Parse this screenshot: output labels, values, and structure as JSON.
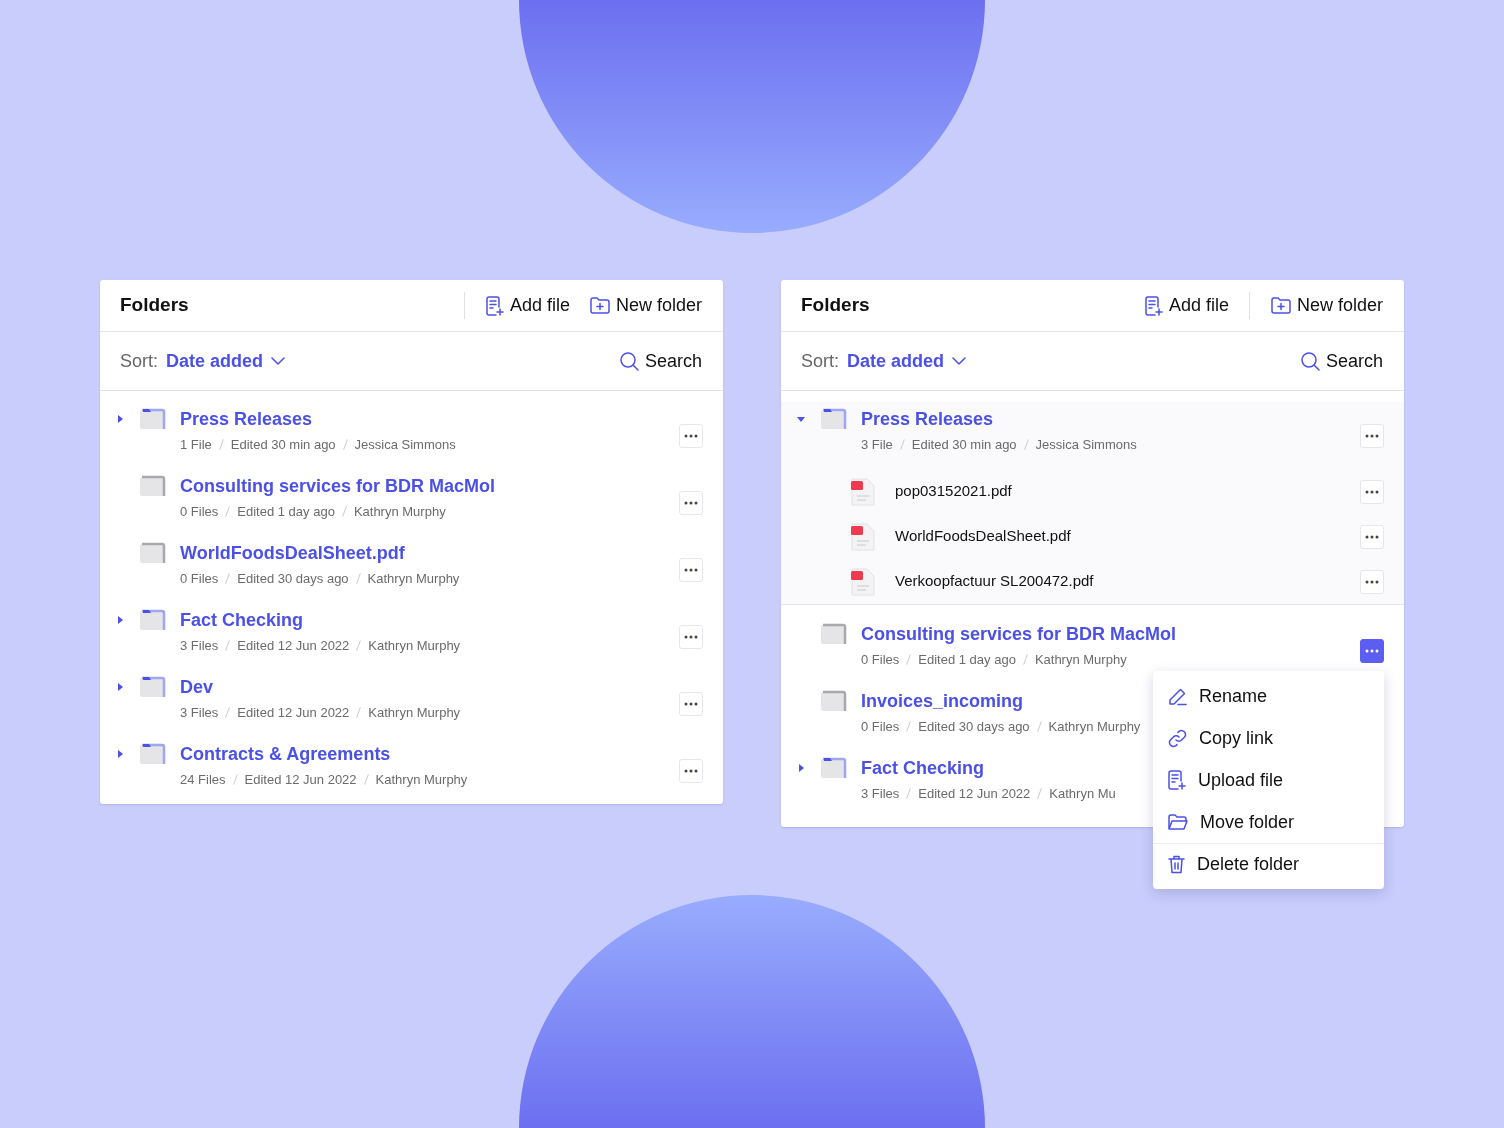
{
  "panels": [
    {
      "title": "Folders",
      "actions": [
        {
          "label": "Add file",
          "kind": "add-file",
          "separated": true
        },
        {
          "label": "New folder",
          "kind": "new-folder",
          "separated": false
        }
      ],
      "sort": {
        "label": "Sort:",
        "value": "Date added"
      },
      "search": {
        "label": "Search"
      },
      "items": [
        {
          "name": "Press Releases",
          "expandable": true,
          "expanded": false,
          "menu_open": false,
          "meta": [
            "1 File",
            "Edited 30 min ago",
            "Jessica Simmons"
          ]
        },
        {
          "name": "Consulting services for BDR MacMol",
          "expandable": false,
          "menu_open": false,
          "meta": [
            "0 Files",
            "Edited 1 day ago",
            "Kathryn Murphy"
          ]
        },
        {
          "name": "WorldFoodsDealSheet.pdf",
          "expandable": false,
          "menu_open": false,
          "meta": [
            "0 Files",
            "Edited 30 days ago",
            "Kathryn Murphy"
          ]
        },
        {
          "name": "Fact Checking",
          "expandable": true,
          "expanded": false,
          "menu_open": false,
          "meta": [
            "3 Files",
            "Edited 12 Jun 2022",
            "Kathryn Murphy"
          ]
        },
        {
          "name": "Dev",
          "expandable": true,
          "expanded": false,
          "menu_open": false,
          "meta": [
            "3 Files",
            "Edited 12 Jun 2022",
            "Kathryn Murphy"
          ]
        },
        {
          "name": "Contracts & Agreements",
          "expandable": true,
          "expanded": false,
          "menu_open": false,
          "meta": [
            "24 Files",
            "Edited 12 Jun 2022",
            "Kathryn Murphy"
          ]
        }
      ]
    },
    {
      "title": "Folders",
      "actions": [
        {
          "label": "Add file",
          "kind": "add-file",
          "separated": false
        },
        {
          "label": "New folder",
          "kind": "new-folder",
          "separated": true
        }
      ],
      "sort": {
        "label": "Sort:",
        "value": "Date added"
      },
      "search": {
        "label": "Search"
      },
      "items": [
        {
          "name": "Press Releases",
          "expandable": true,
          "expanded": true,
          "menu_open": false,
          "meta": [
            "3 File",
            "Edited 30 min ago",
            "Jessica Simmons"
          ],
          "children": [
            {
              "name": "pop03152021.pdf",
              "kind": "pdf"
            },
            {
              "name": "WorldFoodsDealSheet.pdf",
              "kind": "pdf"
            },
            {
              "name": "Verkoopfactuur SL200472.pdf",
              "kind": "pdf"
            }
          ]
        },
        {
          "name": "Consulting services for BDR MacMol",
          "expandable": false,
          "menu_open": true,
          "meta": [
            "0 Files",
            "Edited 1 day ago",
            "Kathryn Murphy"
          ]
        },
        {
          "name": "Invoices_incoming",
          "expandable": false,
          "menu_open": false,
          "meta": [
            "0 Files",
            "Edited 30 days ago",
            "Kathryn Murphy"
          ]
        },
        {
          "name": "Fact Checking",
          "expandable": true,
          "expanded": false,
          "menu_open": false,
          "meta": [
            "3 Files",
            "Edited 12 Jun 2022",
            "Kathryn Mu"
          ]
        }
      ],
      "menu": {
        "items": [
          {
            "label": "Rename",
            "kind": "rename",
            "separated": false
          },
          {
            "label": "Copy link",
            "kind": "copy-link",
            "separated": false
          },
          {
            "label": "Upload file",
            "kind": "upload-file",
            "separated": false
          },
          {
            "label": "Move folder",
            "kind": "move-folder",
            "separated": false
          },
          {
            "label": "Delete folder",
            "kind": "delete",
            "separated": true
          }
        ]
      }
    }
  ]
}
